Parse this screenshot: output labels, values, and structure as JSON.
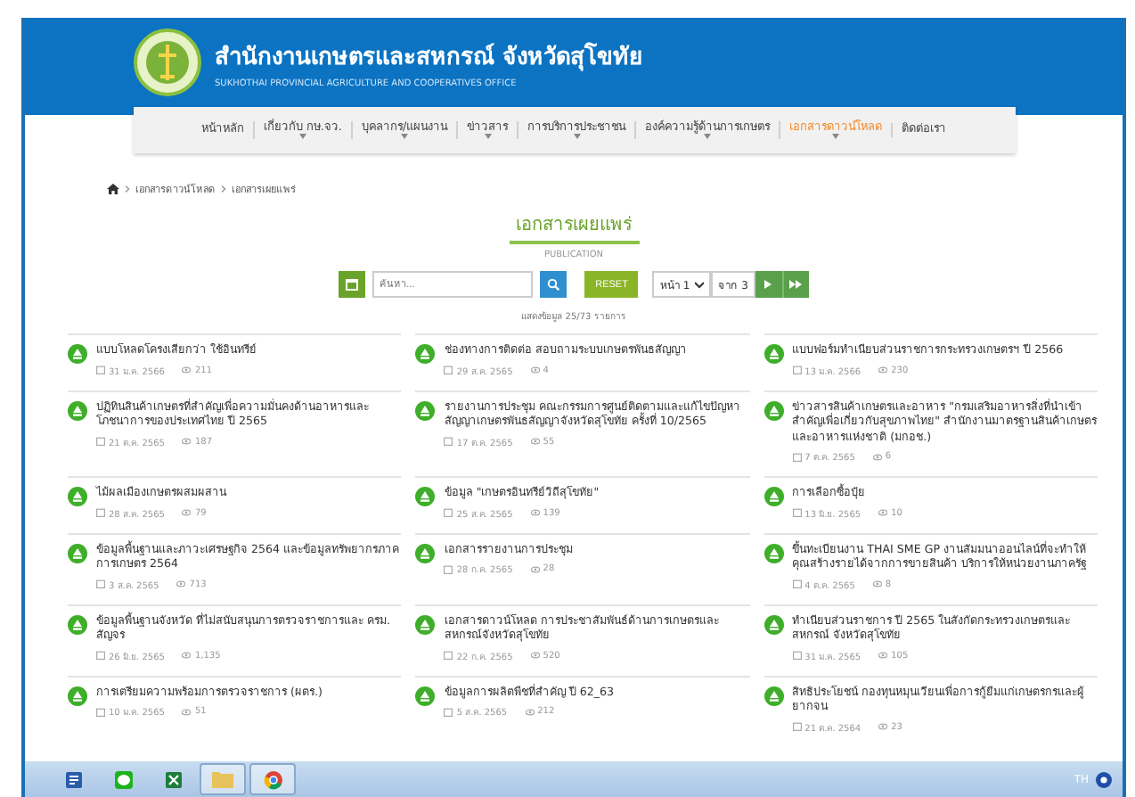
{
  "site": {
    "title": "สำนักงานเกษตรและสหกรณ์ จังหวัดสุโขทัย",
    "subtitle": "SUKHOTHAI PROVINCIAL AGRICULTURE AND COOPERATIVES OFFICE"
  },
  "nav": [
    {
      "label": "หน้าหลัก",
      "selected": false,
      "dropdown": false
    },
    {
      "label": "เกี่ยวกับ กษ.จว.",
      "selected": false,
      "dropdown": true
    },
    {
      "label": "บุคลากร/แผนงาน",
      "selected": false,
      "dropdown": true
    },
    {
      "label": "ข่าวสาร",
      "selected": false,
      "dropdown": true
    },
    {
      "label": "การบริการประชาชน",
      "selected": false,
      "dropdown": true
    },
    {
      "label": "องค์ความรู้ด้านการเกษตร",
      "selected": false,
      "dropdown": true
    },
    {
      "label": "เอกสารดาวน์โหลด",
      "selected": true,
      "dropdown": true
    },
    {
      "label": "ติดต่อเรา",
      "selected": false,
      "dropdown": false
    }
  ],
  "breadcrumb": [
    "เอกสารดาวน์โหลด",
    "เอกสารเผยแพร่"
  ],
  "heading": {
    "title": "เอกสารเผยแพร่",
    "subtitle": "PUBLICATION"
  },
  "toolbar": {
    "search_placeholder": "ค้นหา...",
    "reset": "RESET",
    "page": "หน้า 1",
    "of_pages": "จาก 3"
  },
  "count": "แสดงข้อมูล 25/73 รายการ",
  "documents": [
    {
      "title": "แบบโหลดโครงเสียกว่า ใช้อินทรีย์",
      "date": "31 ม.ค. 2566",
      "views": "211"
    },
    {
      "title": "ช่องทางการติดต่อ สอบถามระบบเกษตรพันธสัญญา",
      "date": "29 ส.ค. 2565",
      "views": "4"
    },
    {
      "title": "แบบฟอร์มทำเนียบส่วนราชการกระทรวงเกษตรฯ ปี 2566",
      "date": "13 ม.ค. 2566",
      "views": "230"
    },
    {
      "title": "ปฏิทินสินค้าเกษตรที่สำคัญเพื่อความมั่นคงด้านอาหารและโภชนาการของประเทศไทย ปี 2565",
      "date": "21 ต.ค. 2565",
      "views": "187"
    },
    {
      "title": "รายงานการประชุม คณะกรรมการศูนย์ติดตามและแก้ไขปัญหาสัญญาเกษตรพันธสัญญาจังหวัดสุโขทัย ครั้งที่ 10/2565",
      "date": "17 ต.ค. 2565",
      "views": "55"
    },
    {
      "title": "ข่าวสารสินค้าเกษตรและอาหาร \"กรมเสริมอาหารสิ่งที่นำเข้าสำคัญเพื่อเกี่ยวกับสุขภาพไทย\" สำนักงานมาตรฐานสินค้าเกษตรและอาหารแห่งชาติ (มกอช.)",
      "date": "7 ต.ค. 2565",
      "views": "6"
    },
    {
      "title": "ไม้ผลเมืองเกษตรผสมผสาน",
      "date": "28 ส.ค. 2565",
      "views": "79"
    },
    {
      "title": "ข้อมูล \"เกษตรอินทรีย์วิถีสุโขทัย\"",
      "date": "25 ส.ค. 2565",
      "views": "139"
    },
    {
      "title": "การเลือกซื้อปุ๋ย",
      "date": "13 มิ.ย. 2565",
      "views": "10"
    },
    {
      "title": "ข้อมูลพื้นฐานและภาวะเศรษฐกิจ 2564 และข้อมูลทรัพยากรภาคการเกษตร 2564",
      "date": "3 ส.ค. 2565",
      "views": "713"
    },
    {
      "title": "เอกสารรายงานการประชุม",
      "date": "28 ก.ค. 2565",
      "views": "28"
    },
    {
      "title": "ขึ้นทะเบียนงาน THAI SME GP งานสัมมนาออนไลน์ที่จะทำให้คุณสร้างรายได้จากการขายสินค้า บริการให้หน่วยงานภาครัฐ",
      "date": "4 ต.ค. 2565",
      "views": "8"
    },
    {
      "title": "ข้อมูลพื้นฐานจังหวัด ที่ไม่สนับสนุนการตรวจราชการและ ครม. สัญจร",
      "date": "26 มิ.ย. 2565",
      "views": "1,135"
    },
    {
      "title": "เอกสารดาวน์โหลด การประชาสัมพันธ์ด้านการเกษตรและสหกรณ์จังหวัดสุโขทัย",
      "date": "22 ก.ค. 2565",
      "views": "520"
    },
    {
      "title": "ทำเนียบส่วนราชการ ปี 2565 ในสังกัดกระทรวงเกษตรและสหกรณ์ จังหวัดสุโขทัย",
      "date": "31 ม.ค. 2565",
      "views": "105"
    },
    {
      "title": "การเตรียมความพร้อมการตรวจราชการ (ผตร.)",
      "date": "10 ม.ค. 2565",
      "views": "51"
    },
    {
      "title": "ข้อมูลการผลิตพืชที่สำคัญ ปี 62_63",
      "date": "5 ส.ค. 2565",
      "views": "212"
    },
    {
      "title": "สิทธิประโยชน์ กองทุนหมุนเวียนเพื่อการกู้ยืมแก่เกษตรกรและผู้ยากจน",
      "date": "21 ต.ค. 2564",
      "views": "23"
    }
  ],
  "taskbar": {
    "apps": [
      {
        "kind": "document",
        "selected": false
      },
      {
        "kind": "chat",
        "selected": false
      },
      {
        "kind": "spreadsheet",
        "selected": false
      },
      {
        "kind": "folder",
        "selected": true
      },
      {
        "kind": "browser",
        "selected": true
      }
    ],
    "language": "TH"
  }
}
